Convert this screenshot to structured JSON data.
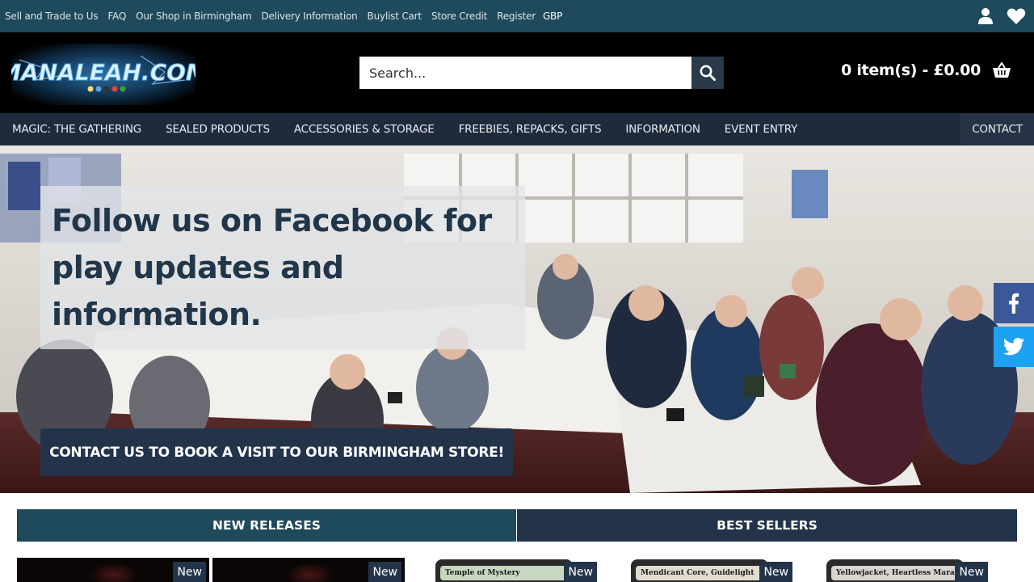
{
  "topbar": {
    "links": [
      "Sell and Trade to Us",
      "FAQ",
      "Our Shop in Birmingham",
      "Delivery Information",
      "Buylist Cart",
      "Store Credit",
      "Register"
    ],
    "currency": "GBP"
  },
  "header": {
    "logo_text": "MANALEAH.COM",
    "search_placeholder": "Search...",
    "cart_text": "0 item(s) - £0.00"
  },
  "nav": {
    "items": [
      "MAGIC: THE GATHERING",
      "SEALED PRODUCTS",
      "ACCESSORIES & STORAGE",
      "FREEBIES, REPACKS, GIFTS",
      "INFORMATION",
      "EVENT ENTRY"
    ],
    "contact": "CONTACT"
  },
  "hero": {
    "caption": "Follow us on Facebook for play updates and information.",
    "cta": "CONTACT US TO BOOK A VISIT TO OUR BIRMINGHAM STORE!"
  },
  "tabs": {
    "new_releases": "NEW RELEASES",
    "best_sellers": "BEST SELLERS"
  },
  "products": [
    {
      "badge": "New",
      "card_title": ""
    },
    {
      "badge": "New",
      "card_title": ""
    },
    {
      "badge": "New",
      "card_title": "Temple of Mystery"
    },
    {
      "badge": "New",
      "card_title": "Mendicant Core, Guidelight"
    },
    {
      "badge": "New",
      "card_title": "Yellowjacket, Heartless Marauder"
    }
  ],
  "colors": {
    "topbar": "#1e4a5b",
    "header": "#000000",
    "nav": "#1f2a3a",
    "accent_dark": "#23344a",
    "facebook": "#3b5998",
    "twitter": "#1da1f2"
  }
}
